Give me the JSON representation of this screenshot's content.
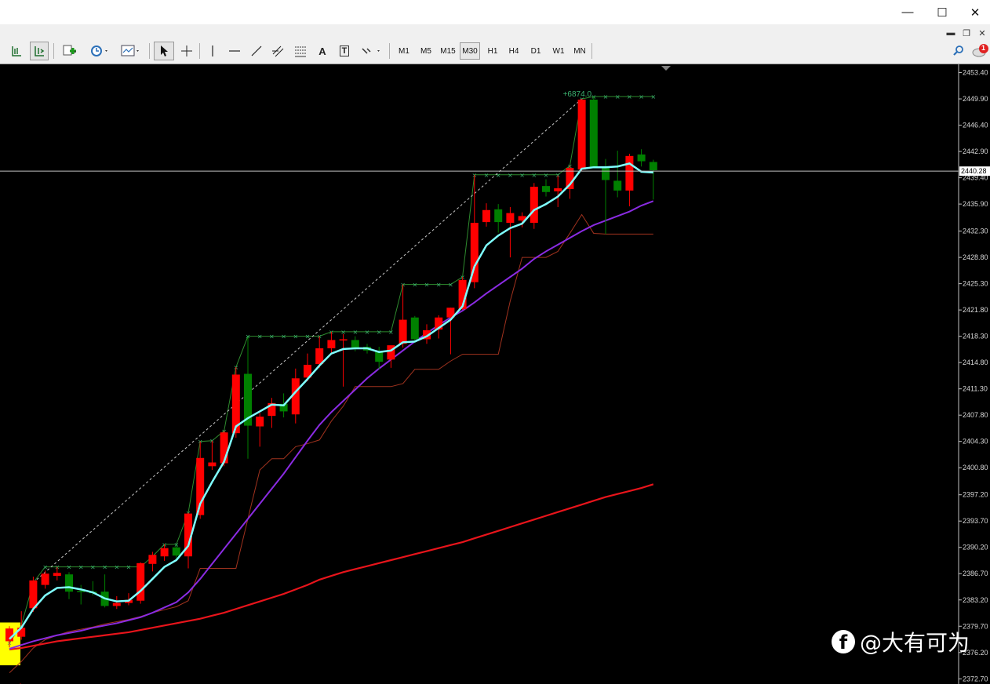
{
  "window": {
    "minimize_glyph": "—",
    "maximize_glyph": "☐",
    "close_glyph": "✕"
  },
  "mdi": {
    "min": "▬",
    "restore": "❐",
    "close": "✕"
  },
  "toolbar": {
    "timeframes": [
      "M1",
      "M5",
      "M15",
      "M30",
      "H1",
      "H4",
      "D1",
      "W1",
      "MN"
    ],
    "active_timeframe": "M30",
    "text_tool": "A",
    "label_tool": "T",
    "notification_count": "1"
  },
  "price_axis": {
    "ticks": [
      "2453.40",
      "2449.90",
      "2446.40",
      "2442.90",
      "2439.40",
      "2435.90",
      "2432.30",
      "2428.80",
      "2425.30",
      "2421.80",
      "2418.30",
      "2414.80",
      "2411.30",
      "2407.80",
      "2404.30",
      "2400.80",
      "2397.20",
      "2393.70",
      "2390.20",
      "2386.70",
      "2383.20",
      "2379.70",
      "2376.20",
      "2372.70"
    ],
    "current_price": "2440.28"
  },
  "annotation": {
    "profit_label": "+6874.0"
  },
  "watermark": {
    "text": "@大有可为"
  },
  "colors": {
    "bull_candle": "#ff0000",
    "bear_candle": "#008000",
    "fast_ma": "#7fffff",
    "mid_ma": "#8a2be2",
    "slow_ma": "#e8141b",
    "channel_upper": "#2e8b2e",
    "channel_lower": "#a0321e",
    "highlight": "#ffff00"
  },
  "chart_data": {
    "type": "candlestick",
    "symbol_timeframe": "M30",
    "ylim": [
      2372.0,
      2454.5
    ],
    "candles": [
      {
        "o": 2377.7,
        "h": 2379.7,
        "l": 2376.9,
        "c": 2379.4
      },
      {
        "o": 2378.3,
        "h": 2381.7,
        "l": 2377.9,
        "c": 2379.5
      },
      {
        "o": 2382.1,
        "h": 2386.3,
        "l": 2381.6,
        "c": 2385.8
      },
      {
        "o": 2385.2,
        "h": 2387.1,
        "l": 2384.7,
        "c": 2386.7
      },
      {
        "o": 2386.4,
        "h": 2387.6,
        "l": 2385.8,
        "c": 2386.8
      },
      {
        "o": 2386.6,
        "h": 2386.9,
        "l": 2383.3,
        "c": 2384.3
      },
      {
        "o": 2384.4,
        "h": 2385.2,
        "l": 2382.6,
        "c": 2384.3
      },
      {
        "o": 2384.3,
        "h": 2385.7,
        "l": 2383.8,
        "c": 2384.1
      },
      {
        "o": 2384.3,
        "h": 2386.6,
        "l": 2382.2,
        "c": 2382.4
      },
      {
        "o": 2382.4,
        "h": 2383.7,
        "l": 2382.0,
        "c": 2382.8
      },
      {
        "o": 2382.8,
        "h": 2384.1,
        "l": 2382.5,
        "c": 2383.2
      },
      {
        "o": 2383.1,
        "h": 2388.2,
        "l": 2382.7,
        "c": 2388.1
      },
      {
        "o": 2388.0,
        "h": 2389.6,
        "l": 2387.0,
        "c": 2389.2
      },
      {
        "o": 2389.0,
        "h": 2390.6,
        "l": 2388.4,
        "c": 2390.1
      },
      {
        "o": 2390.2,
        "h": 2390.5,
        "l": 2388.6,
        "c": 2389.1
      },
      {
        "o": 2389.0,
        "h": 2394.8,
        "l": 2387.4,
        "c": 2394.7
      },
      {
        "o": 2394.5,
        "h": 2404.3,
        "l": 2394.0,
        "c": 2402.1
      },
      {
        "o": 2401.0,
        "h": 2404.4,
        "l": 2400.5,
        "c": 2401.5
      },
      {
        "o": 2401.4,
        "h": 2405.7,
        "l": 2401.0,
        "c": 2405.5
      },
      {
        "o": 2405.4,
        "h": 2414.2,
        "l": 2404.8,
        "c": 2413.2
      },
      {
        "o": 2413.3,
        "h": 2418.2,
        "l": 2402.0,
        "c": 2406.4
      },
      {
        "o": 2406.3,
        "h": 2408.1,
        "l": 2403.6,
        "c": 2407.6
      },
      {
        "o": 2407.7,
        "h": 2410.1,
        "l": 2406.1,
        "c": 2409.4
      },
      {
        "o": 2409.3,
        "h": 2410.7,
        "l": 2407.5,
        "c": 2408.3
      },
      {
        "o": 2407.9,
        "h": 2414.0,
        "l": 2406.7,
        "c": 2412.7
      },
      {
        "o": 2412.8,
        "h": 2416.0,
        "l": 2412.3,
        "c": 2414.5
      },
      {
        "o": 2414.6,
        "h": 2418.3,
        "l": 2414.1,
        "c": 2416.7
      },
      {
        "o": 2416.7,
        "h": 2418.9,
        "l": 2416.1,
        "c": 2417.8
      },
      {
        "o": 2417.9,
        "h": 2418.6,
        "l": 2411.6,
        "c": 2417.9
      },
      {
        "o": 2417.8,
        "h": 2418.3,
        "l": 2416.3,
        "c": 2416.8
      },
      {
        "o": 2416.9,
        "h": 2417.3,
        "l": 2416.0,
        "c": 2416.4
      },
      {
        "o": 2416.3,
        "h": 2416.9,
        "l": 2413.9,
        "c": 2414.9
      },
      {
        "o": 2415.2,
        "h": 2416.9,
        "l": 2414.1,
        "c": 2417.1
      },
      {
        "o": 2417.3,
        "h": 2425.2,
        "l": 2416.8,
        "c": 2420.5
      },
      {
        "o": 2420.8,
        "h": 2421.0,
        "l": 2417.4,
        "c": 2417.9
      },
      {
        "o": 2417.9,
        "h": 2419.9,
        "l": 2417.3,
        "c": 2419.1
      },
      {
        "o": 2419.2,
        "h": 2421.1,
        "l": 2418.0,
        "c": 2420.8
      },
      {
        "o": 2420.8,
        "h": 2422.1,
        "l": 2415.9,
        "c": 2422.1
      },
      {
        "o": 2421.9,
        "h": 2426.2,
        "l": 2421.8,
        "c": 2425.8
      },
      {
        "o": 2425.5,
        "h": 2439.8,
        "l": 2424.7,
        "c": 2433.4
      },
      {
        "o": 2433.5,
        "h": 2436.0,
        "l": 2432.9,
        "c": 2435.1
      },
      {
        "o": 2435.2,
        "h": 2435.9,
        "l": 2432.1,
        "c": 2433.5
      },
      {
        "o": 2433.4,
        "h": 2435.5,
        "l": 2428.8,
        "c": 2434.7
      },
      {
        "o": 2433.7,
        "h": 2434.8,
        "l": 2432.8,
        "c": 2434.3
      },
      {
        "o": 2433.4,
        "h": 2438.7,
        "l": 2432.6,
        "c": 2438.2
      },
      {
        "o": 2438.3,
        "h": 2439.2,
        "l": 2436.9,
        "c": 2437.5
      },
      {
        "o": 2437.6,
        "h": 2439.7,
        "l": 2435.5,
        "c": 2438.0
      },
      {
        "o": 2437.9,
        "h": 2441.0,
        "l": 2436.6,
        "c": 2440.7
      },
      {
        "o": 2440.5,
        "h": 2449.9,
        "l": 2440.3,
        "c": 2449.8
      },
      {
        "o": 2449.8,
        "h": 2450.2,
        "l": 2441.2,
        "c": 2440.8
      },
      {
        "o": 2440.8,
        "h": 2441.9,
        "l": 2431.9,
        "c": 2439.1
      },
      {
        "o": 2439.0,
        "h": 2443.0,
        "l": 2436.8,
        "c": 2437.7
      },
      {
        "o": 2437.7,
        "h": 2442.6,
        "l": 2435.6,
        "c": 2442.3
      },
      {
        "o": 2442.5,
        "h": 2443.2,
        "l": 2440.9,
        "c": 2441.6
      },
      {
        "o": 2441.5,
        "h": 2441.8,
        "l": 2436.5,
        "c": 2440.4
      }
    ],
    "fast_ma": [
      2378.0,
      2379.5,
      2382.0,
      2383.8,
      2384.8,
      2384.9,
      2384.6,
      2384.2,
      2383.4,
      2383.0,
      2383.1,
      2384.4,
      2386.0,
      2387.6,
      2388.5,
      2390.4,
      2396.0,
      2398.9,
      2401.6,
      2406.3,
      2407.4,
      2408.3,
      2409.2,
      2409.1,
      2410.9,
      2412.6,
      2414.4,
      2416.0,
      2416.6,
      2416.7,
      2416.7,
      2416.2,
      2416.4,
      2417.5,
      2417.6,
      2418.3,
      2419.4,
      2420.5,
      2422.3,
      2427.6,
      2430.4,
      2431.7,
      2432.7,
      2433.3,
      2435.1,
      2435.9,
      2436.9,
      2438.5,
      2440.6,
      2440.8,
      2440.8,
      2440.9,
      2441.3,
      2440.2,
      2440.1
    ],
    "mid_ma": [
      2376.7,
      2377.2,
      2377.7,
      2378.1,
      2378.5,
      2378.8,
      2379.1,
      2379.5,
      2379.8,
      2380.1,
      2380.5,
      2380.9,
      2381.5,
      2382.2,
      2382.9,
      2384.2,
      2386.0,
      2388.0,
      2390.0,
      2392.0,
      2394.0,
      2396.0,
      2398.0,
      2400.0,
      2402.2,
      2404.4,
      2406.5,
      2408.2,
      2409.7,
      2411.2,
      2412.7,
      2414.0,
      2415.2,
      2416.4,
      2417.6,
      2418.7,
      2419.8,
      2420.8,
      2421.7,
      2422.8,
      2424.0,
      2425.1,
      2426.2,
      2427.3,
      2428.6,
      2429.6,
      2430.5,
      2431.4,
      2432.3,
      2433.1,
      2433.7,
      2434.3,
      2434.9,
      2435.7,
      2436.3
    ],
    "slow_ma": [
      2376.6,
      2376.8,
      2377.1,
      2377.4,
      2377.7,
      2377.9,
      2378.1,
      2378.3,
      2378.5,
      2378.7,
      2378.9,
      2379.2,
      2379.5,
      2379.8,
      2380.1,
      2380.4,
      2380.7,
      2381.1,
      2381.5,
      2382.0,
      2382.5,
      2383.0,
      2383.5,
      2384.0,
      2384.6,
      2385.2,
      2385.9,
      2386.4,
      2386.9,
      2387.3,
      2387.7,
      2388.1,
      2388.5,
      2388.9,
      2389.3,
      2389.7,
      2390.1,
      2390.5,
      2390.9,
      2391.4,
      2391.9,
      2392.4,
      2392.9,
      2393.4,
      2393.9,
      2394.4,
      2394.9,
      2395.4,
      2395.9,
      2396.4,
      2396.9,
      2397.3,
      2397.7,
      2398.1,
      2398.6
    ],
    "channel_upper": [
      2377.5,
      2379.8,
      2385.5,
      2387.6,
      2387.6,
      2387.6,
      2387.6,
      2387.6,
      2387.6,
      2387.6,
      2387.6,
      2387.6,
      2389.0,
      2390.6,
      2390.6,
      2394.8,
      2404.3,
      2404.4,
      2405.7,
      2414.2,
      2418.3,
      2418.3,
      2418.3,
      2418.3,
      2418.3,
      2418.3,
      2418.3,
      2418.9,
      2418.9,
      2418.9,
      2418.9,
      2418.9,
      2418.9,
      2425.2,
      2425.2,
      2425.2,
      2425.2,
      2425.2,
      2426.2,
      2439.8,
      2439.8,
      2439.8,
      2439.8,
      2439.8,
      2439.8,
      2439.8,
      2439.8,
      2441.0,
      2449.9,
      2450.2,
      2450.2,
      2450.2,
      2450.2,
      2450.2,
      2450.2
    ],
    "channel_lower": [
      2373.5,
      2375.0,
      2376.8,
      2377.9,
      2378.5,
      2379.0,
      2379.3,
      2379.6,
      2380.0,
      2380.3,
      2380.6,
      2381.0,
      2381.5,
      2381.9,
      2382.3,
      2383.1,
      2387.4,
      2387.4,
      2387.4,
      2387.4,
      2394.0,
      2400.5,
      2402.0,
      2402.0,
      2403.6,
      2404.0,
      2404.5,
      2407.0,
      2409.0,
      2411.6,
      2411.6,
      2411.6,
      2411.6,
      2412.0,
      2413.9,
      2413.9,
      2413.9,
      2415.0,
      2415.9,
      2415.9,
      2415.9,
      2415.9,
      2423.0,
      2428.8,
      2428.8,
      2428.8,
      2429.6,
      2432.0,
      2434.5,
      2432.0,
      2431.9,
      2431.9,
      2431.9,
      2431.9,
      2431.9
    ],
    "current_price": 2440.28,
    "profit_marker": {
      "candle_index": 48,
      "price": 2449.9
    }
  }
}
